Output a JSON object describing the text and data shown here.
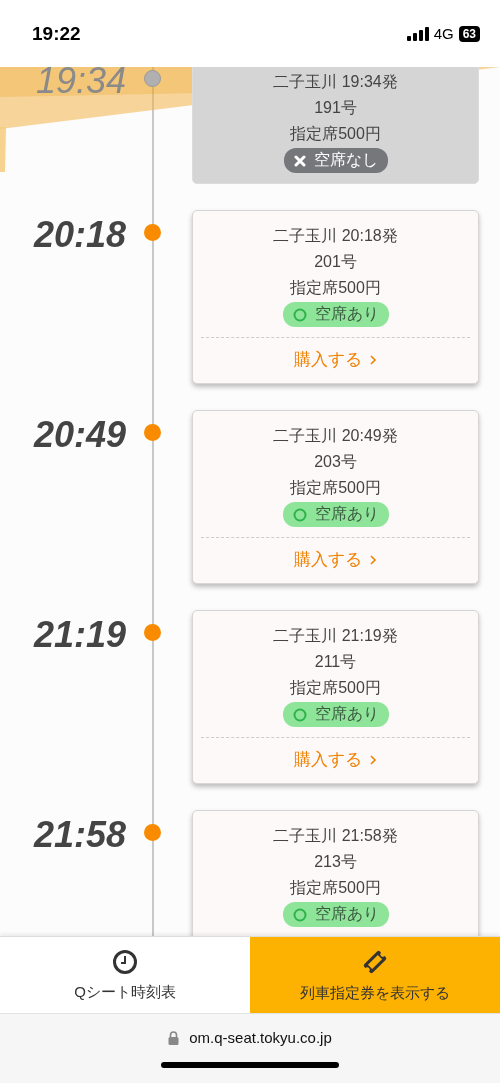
{
  "status_bar": {
    "time": "19:22",
    "network": "4G",
    "battery": "63"
  },
  "trains": [
    {
      "time": "19:34",
      "departed": true,
      "departure": "二子玉川 19:34発",
      "number": "191号",
      "price": "指定席500円",
      "seat_status": {
        "kind": "full",
        "label": "空席なし"
      }
    },
    {
      "time": "20:18",
      "departed": false,
      "departure": "二子玉川 20:18発",
      "number": "201号",
      "price": "指定席500円",
      "seat_status": {
        "kind": "available",
        "label": "空席あり"
      },
      "link": "購入する"
    },
    {
      "time": "20:49",
      "departed": false,
      "departure": "二子玉川 20:49発",
      "number": "203号",
      "price": "指定席500円",
      "seat_status": {
        "kind": "available",
        "label": "空席あり"
      },
      "link": "購入する"
    },
    {
      "time": "21:19",
      "departed": false,
      "departure": "二子玉川 21:19発",
      "number": "211号",
      "price": "指定席500円",
      "seat_status": {
        "kind": "available",
        "label": "空席あり"
      },
      "link": "購入する"
    },
    {
      "time": "21:58",
      "departed": false,
      "departure": "二子玉川 21:58発",
      "number": "213号",
      "price": "指定席500円",
      "seat_status": {
        "kind": "available",
        "label": "空席あり"
      }
    }
  ],
  "bottom_nav": [
    {
      "label": "Qシート時刻表",
      "kind": "clock",
      "selected": false
    },
    {
      "label": "列車指定券を表示する",
      "kind": "ticket",
      "selected": true
    }
  ],
  "url_bar": {
    "url": "om.q-seat.tokyu.co.jp"
  }
}
